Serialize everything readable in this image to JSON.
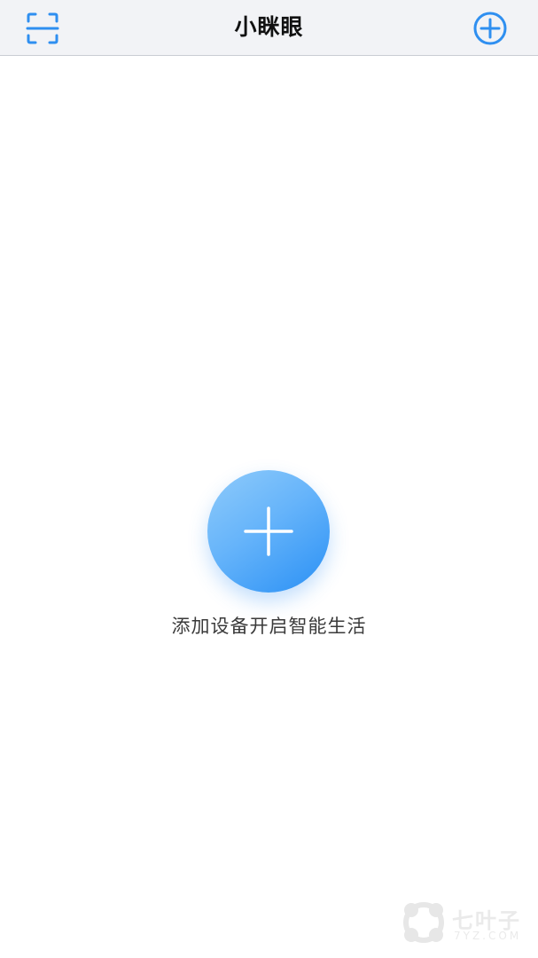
{
  "header": {
    "title": "小眯眼",
    "left_icon": "scan-icon",
    "right_icon": "add-circle-icon"
  },
  "empty_state": {
    "icon": "plus-icon",
    "message": "添加设备开启智能生活"
  },
  "watermark": {
    "cn": "七叶子",
    "en": "7YZ.COM"
  },
  "colors": {
    "accent": "#2f8ff0",
    "nav_bg": "#f2f3f6",
    "text_primary": "#111111",
    "text_secondary": "#3a3a3a"
  }
}
